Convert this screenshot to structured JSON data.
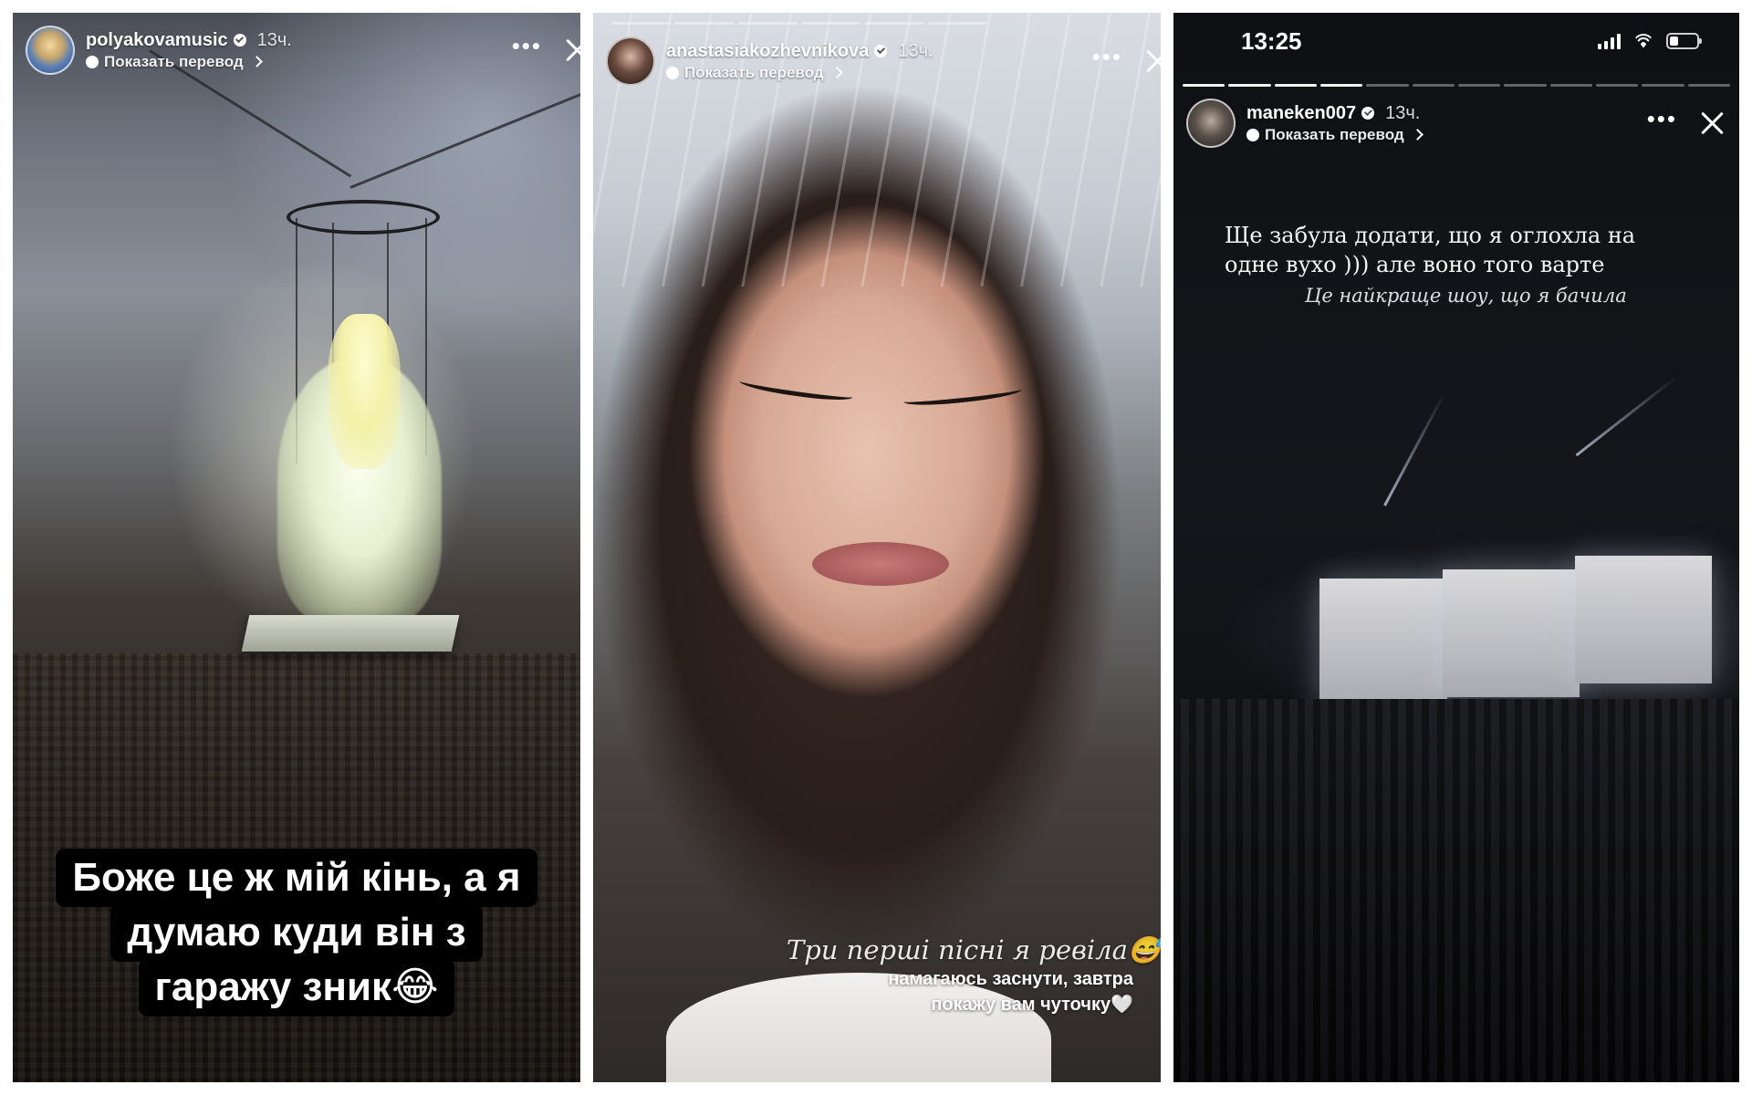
{
  "stories": [
    {
      "username": "polyakovamusic",
      "time": "13ч.",
      "translate": "Показать перевод",
      "caption_lines": [
        "Боже це ж мій кінь, а я",
        "думаю куди він з",
        "гаражу зник😂"
      ]
    },
    {
      "username": "anastasiakozhevnikova",
      "time": "13ч.",
      "translate": "Показать перевод",
      "caption_script": "Три перші пісні я ревіла😅",
      "caption_lines": [
        "намагаюсь заснути, завтра",
        "покажу вам чуточку🤍"
      ]
    },
    {
      "status_time": "13:25",
      "username": "maneken007",
      "time": "13ч.",
      "translate": "Показать перевод",
      "text_lines": [
        "Ще забула додати, що я оглохла на",
        "одне вухо ))) але воно того варте",
        "Це найкраще шоу, що я бачила"
      ]
    }
  ]
}
